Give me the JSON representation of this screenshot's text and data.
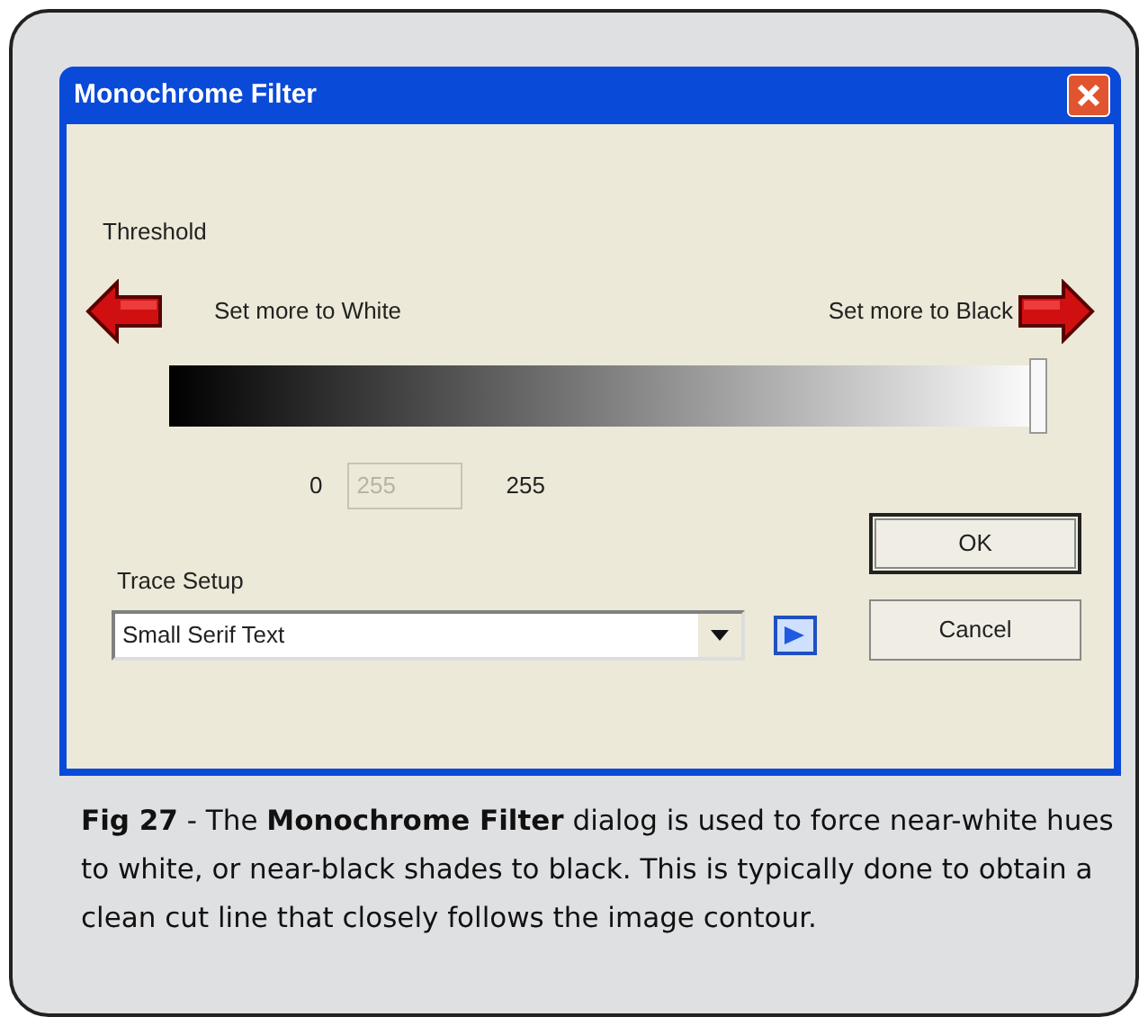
{
  "window": {
    "title": "Monochrome Filter"
  },
  "threshold": {
    "label": "Threshold",
    "left_hint": "Set more to White",
    "right_hint": "Set more to Black",
    "level": 1,
    "min": "0",
    "value": "255",
    "value_disabled": true,
    "max": "255"
  },
  "trace_setup": {
    "label": "Trace Setup",
    "value": "Small Serif Text"
  },
  "buttons": [
    {
      "label": "OK",
      "default": true
    },
    {
      "label": "Cancel",
      "default": false
    }
  ],
  "caption": "**Fig 27** - The **Monochrome Filter** dialog is used to force near-white hues to white, or near-black shades to black. This is typically done to obtain a clean cut line that closely follows the image contour."
}
